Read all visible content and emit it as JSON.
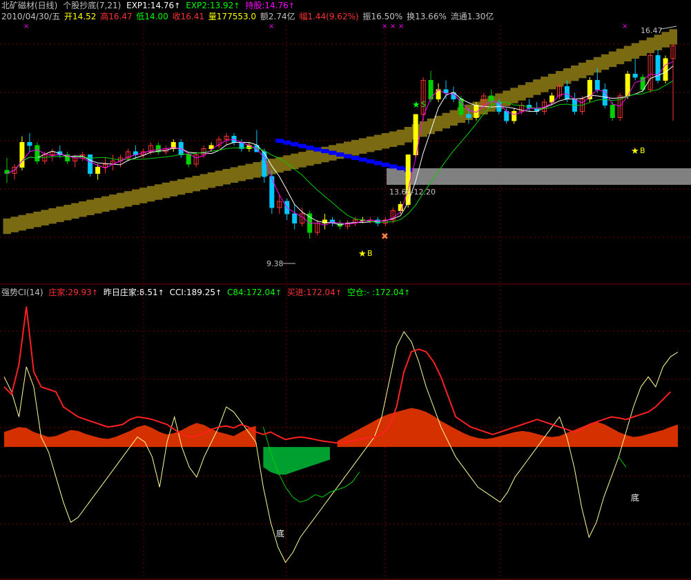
{
  "header": {
    "stock_name": "北矿磁材(日线)",
    "indicator": "个股抄底(7,21)",
    "exp1_label": "EXP1:14.76",
    "exp2_label": "EXP2:13.92",
    "hold_label": "持股:14.76"
  },
  "info": {
    "date": "2010/04/30/五",
    "open": "开14.52",
    "high": "高16.47",
    "low": "低14.00",
    "close": "收16.41",
    "volume": "量177553.0",
    "amount": "额2.74亿",
    "change": "幅1.44(9.62%)",
    "amplitude": "振16.50%",
    "turnover": "换13.66%",
    "float": "流通1.30亿"
  },
  "lower_header": {
    "name": "强势CI(14)",
    "zhuangjia": "庄家:29.93",
    "yesterday": "昨日庄家:8.51",
    "cci": "CCI:189.25",
    "c84": "C84:172.04",
    "buy": "买进:172.04",
    "empty": "空仓:- :172.04"
  },
  "annotations": {
    "high_price": "16.47",
    "low_price": "9.38",
    "range": "13.66-12.20",
    "b_label": "B",
    "s_label": "S",
    "bottom_label": "底"
  },
  "colors": {
    "up": "#ff3232",
    "down": "#00c8ff",
    "green": "#00d000",
    "yellow": "#ffff00",
    "magenta": "#ff00ff",
    "blue": "#0000ff",
    "band": "#7a6a12",
    "gray": "#808080",
    "red_line": "#ff2020",
    "orange_fill": "#d43000",
    "green_fill": "#00a030",
    "grid": "#7a0000"
  },
  "chart_data": [
    {
      "type": "candlestick",
      "title": "北矿磁材(日线)",
      "ylim": [
        9.0,
        17.0
      ],
      "series": [
        {
          "name": "EXP1",
          "last": 14.76
        },
        {
          "name": "EXP2",
          "last": 13.92
        },
        {
          "name": "持股",
          "last": 14.76
        }
      ],
      "values": [
        [
          12.4,
          12.8,
          12.0,
          12.3
        ],
        [
          12.3,
          12.6,
          12.1,
          12.5
        ],
        [
          12.5,
          13.5,
          12.4,
          13.3
        ],
        [
          13.3,
          13.6,
          13.0,
          13.2
        ],
        [
          13.2,
          13.3,
          12.6,
          12.7
        ],
        [
          12.7,
          13.0,
          12.6,
          12.9
        ],
        [
          12.9,
          13.1,
          12.7,
          13.0
        ],
        [
          13.0,
          13.2,
          12.8,
          12.9
        ],
        [
          12.9,
          13.0,
          12.6,
          12.7
        ],
        [
          12.7,
          12.9,
          12.5,
          12.8
        ],
        [
          12.8,
          13.0,
          12.7,
          12.9
        ],
        [
          12.9,
          12.9,
          12.2,
          12.3
        ],
        [
          12.3,
          12.6,
          12.1,
          12.5
        ],
        [
          12.5,
          12.8,
          12.3,
          12.6
        ],
        [
          12.6,
          12.9,
          12.4,
          12.7
        ],
        [
          12.7,
          12.9,
          12.5,
          12.8
        ],
        [
          12.8,
          13.1,
          12.7,
          13.0
        ],
        [
          13.0,
          13.2,
          12.8,
          12.9
        ],
        [
          12.9,
          13.1,
          12.8,
          13.0
        ],
        [
          13.0,
          13.3,
          12.9,
          13.2
        ],
        [
          13.2,
          13.3,
          12.9,
          13.0
        ],
        [
          13.0,
          13.2,
          12.9,
          13.1
        ],
        [
          13.1,
          13.4,
          13.0,
          13.3
        ],
        [
          13.3,
          13.4,
          12.8,
          12.9
        ],
        [
          12.9,
          13.0,
          12.5,
          12.6
        ],
        [
          12.6,
          13.0,
          12.5,
          12.9
        ],
        [
          12.9,
          13.2,
          12.8,
          13.1
        ],
        [
          13.1,
          13.3,
          13.0,
          13.2
        ],
        [
          13.2,
          13.5,
          13.1,
          13.4
        ],
        [
          13.4,
          13.6,
          13.2,
          13.5
        ],
        [
          13.5,
          13.6,
          13.2,
          13.3
        ],
        [
          13.3,
          13.4,
          13.0,
          13.1
        ],
        [
          13.1,
          13.3,
          13.0,
          13.2
        ],
        [
          13.2,
          13.7,
          13.1,
          13.0
        ],
        [
          13.0,
          13.1,
          12.0,
          12.2
        ],
        [
          12.2,
          12.4,
          11.0,
          11.2
        ],
        [
          11.2,
          11.6,
          11.0,
          11.4
        ],
        [
          11.4,
          11.5,
          10.8,
          11.0
        ],
        [
          11.0,
          11.3,
          10.5,
          10.7
        ],
        [
          10.7,
          11.2,
          10.6,
          11.0
        ],
        [
          11.0,
          11.1,
          10.2,
          10.4
        ],
        [
          10.4,
          10.8,
          10.3,
          10.7
        ],
        [
          10.7,
          11.0,
          10.5,
          10.8
        ],
        [
          10.8,
          10.9,
          10.6,
          10.7
        ],
        [
          10.7,
          10.8,
          10.5,
          10.6
        ],
        [
          10.6,
          10.8,
          10.5,
          10.7
        ],
        [
          10.7,
          10.9,
          10.6,
          10.8
        ],
        [
          10.8,
          10.9,
          10.7,
          10.8
        ],
        [
          10.8,
          10.9,
          10.7,
          10.8
        ],
        [
          10.8,
          10.9,
          10.6,
          10.7
        ],
        [
          10.7,
          10.9,
          10.6,
          10.8
        ],
        [
          10.8,
          11.2,
          10.7,
          11.1
        ],
        [
          11.1,
          11.4,
          11.0,
          11.3
        ],
        [
          11.3,
          12.9,
          11.2,
          12.9
        ],
        [
          12.9,
          14.2,
          12.8,
          14.2
        ],
        [
          14.2,
          15.4,
          14.0,
          15.3
        ],
        [
          15.3,
          15.6,
          14.6,
          14.7
        ],
        [
          14.7,
          15.2,
          14.6,
          15.0
        ],
        [
          15.0,
          15.3,
          14.7,
          14.9
        ],
        [
          14.9,
          15.1,
          14.6,
          14.7
        ],
        [
          14.7,
          14.8,
          14.1,
          14.2
        ],
        [
          14.2,
          14.4,
          13.9,
          14.1
        ],
        [
          14.1,
          14.6,
          14.0,
          14.5
        ],
        [
          14.5,
          14.9,
          14.4,
          14.8
        ],
        [
          14.8,
          15.0,
          14.5,
          14.6
        ],
        [
          14.6,
          14.7,
          14.2,
          14.3
        ],
        [
          14.3,
          14.4,
          13.9,
          14.0
        ],
        [
          14.0,
          14.4,
          13.9,
          14.3
        ],
        [
          14.3,
          14.6,
          14.2,
          14.5
        ],
        [
          14.5,
          14.7,
          14.3,
          14.4
        ],
        [
          14.4,
          14.6,
          14.2,
          14.3
        ],
        [
          14.3,
          14.7,
          14.2,
          14.6
        ],
        [
          14.6,
          14.9,
          14.5,
          14.8
        ],
        [
          14.8,
          15.2,
          14.7,
          15.1
        ],
        [
          15.1,
          15.3,
          14.6,
          14.7
        ],
        [
          14.7,
          14.9,
          14.2,
          14.3
        ],
        [
          14.3,
          14.8,
          14.2,
          14.7
        ],
        [
          14.7,
          15.4,
          14.6,
          15.3
        ],
        [
          15.3,
          15.7,
          14.9,
          15.0
        ],
        [
          15.0,
          15.2,
          14.4,
          14.5
        ],
        [
          14.5,
          14.6,
          14.0,
          14.1
        ],
        [
          14.1,
          14.9,
          14.0,
          14.8
        ],
        [
          14.8,
          15.6,
          14.7,
          15.5
        ],
        [
          15.5,
          16.0,
          15.3,
          15.4
        ],
        [
          15.4,
          15.5,
          14.9,
          15.0
        ],
        [
          15.0,
          16.2,
          14.9,
          16.1
        ],
        [
          16.1,
          16.3,
          15.2,
          15.3
        ],
        [
          15.3,
          16.1,
          15.2,
          16.0
        ],
        [
          16.0,
          16.47,
          14.0,
          16.41
        ]
      ]
    },
    {
      "type": "line",
      "title": "强势CI(14)",
      "series": [
        {
          "name": "庄家",
          "last": 29.93
        },
        {
          "name": "昨日庄家",
          "last": 8.51
        },
        {
          "name": "CCI",
          "last": 189.25
        },
        {
          "name": "C84",
          "last": 172.04
        },
        {
          "name": "买进",
          "last": 172.04
        },
        {
          "name": "空仓",
          "last": 172.04
        }
      ],
      "ylim": [
        -250,
        300
      ],
      "zhuangjia_line": [
        120,
        105,
        165,
        280,
        150,
        120,
        115,
        110,
        80,
        70,
        60,
        55,
        50,
        45,
        40,
        42,
        45,
        55,
        60,
        58,
        55,
        50,
        45,
        35,
        25,
        20,
        22,
        28,
        35,
        40,
        42,
        38,
        45,
        40,
        30,
        25,
        30,
        22,
        15,
        18,
        20,
        18,
        15,
        12,
        10,
        8,
        10,
        12,
        15,
        18,
        20,
        25,
        40,
        80,
        150,
        190,
        195,
        190,
        170,
        140,
        100,
        60,
        50,
        40,
        35,
        30,
        25,
        30,
        35,
        40,
        45,
        50,
        55,
        50,
        45,
        40,
        35,
        30,
        35,
        45,
        50,
        55,
        60,
        58,
        55,
        60,
        65,
        70,
        80,
        95,
        110
      ],
      "cci_line": [
        140,
        110,
        60,
        160,
        120,
        20,
        -10,
        -60,
        -110,
        -150,
        -140,
        -120,
        -100,
        -80,
        -60,
        -40,
        -20,
        0,
        20,
        10,
        -20,
        -80,
        10,
        60,
        0,
        -40,
        -60,
        -20,
        10,
        40,
        80,
        70,
        50,
        30,
        10,
        -80,
        -150,
        -200,
        -230,
        -210,
        -180,
        -160,
        -140,
        -120,
        -100,
        -80,
        -60,
        -40,
        -20,
        0,
        20,
        60,
        130,
        200,
        230,
        210,
        170,
        120,
        80,
        40,
        10,
        -20,
        -40,
        -60,
        -80,
        -90,
        -100,
        -110,
        -90,
        -60,
        -40,
        -20,
        0,
        20,
        40,
        60,
        20,
        -40,
        -120,
        -180,
        -150,
        -100,
        -60,
        -20,
        30,
        80,
        120,
        140,
        120,
        160,
        180,
        189.25
      ],
      "green_line": [
        null,
        null,
        null,
        null,
        null,
        null,
        null,
        null,
        null,
        null,
        null,
        null,
        null,
        null,
        null,
        null,
        null,
        null,
        null,
        null,
        null,
        null,
        null,
        null,
        null,
        null,
        null,
        null,
        null,
        null,
        null,
        null,
        null,
        null,
        null,
        40,
        -10,
        -50,
        -80,
        -100,
        -110,
        -105,
        -95,
        -100,
        -90,
        -85,
        -80,
        -70,
        -50,
        null,
        null,
        null,
        null,
        null,
        null,
        null,
        null,
        null,
        null,
        null,
        null,
        null,
        null,
        null,
        null,
        null,
        null,
        null,
        null,
        null,
        null,
        null,
        null,
        null,
        null,
        null,
        null,
        null,
        null,
        null,
        null,
        null,
        null,
        -20,
        -40,
        null,
        null,
        null,
        null,
        null,
        null
      ],
      "orange_area": [
        30,
        35,
        40,
        38,
        30,
        25,
        20,
        22,
        28,
        34,
        32,
        26,
        22,
        18,
        16,
        20,
        26,
        32,
        40,
        44,
        38,
        30,
        25,
        28,
        34,
        42,
        48,
        44,
        36,
        30,
        26,
        22,
        30,
        38,
        42,
        -40,
        -50,
        -55,
        -55,
        -50,
        -45,
        -40,
        -35,
        -30,
        -25,
        12,
        20,
        28,
        36,
        44,
        52,
        60,
        66,
        70,
        74,
        78,
        75,
        70,
        62,
        52,
        44,
        36,
        28,
        22,
        18,
        16,
        18,
        22,
        26,
        30,
        32,
        30,
        26,
        22,
        20,
        22,
        28,
        34,
        40,
        46,
        50,
        46,
        38,
        30,
        24,
        20,
        22,
        26,
        30,
        34,
        40,
        45
      ]
    }
  ]
}
